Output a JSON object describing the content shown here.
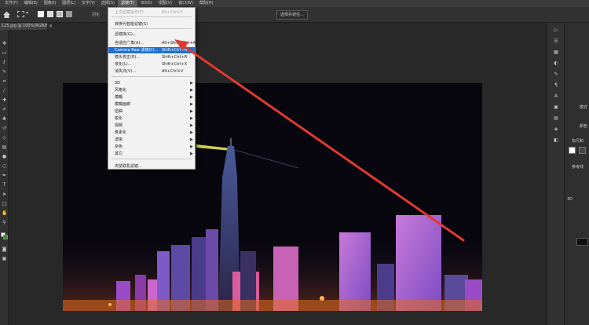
{
  "menubar": {
    "items": [
      "文件(F)",
      "编辑(E)",
      "图像(I)",
      "图层(L)",
      "文字(Y)",
      "选择(S)",
      "滤镜(T)",
      "3D(D)",
      "视图(V)",
      "窗口(W)",
      "帮助(H)"
    ],
    "active_index": 6
  },
  "options": {
    "feather_label": "羽化",
    "select_mask_button": "选择并遮住..."
  },
  "document_tab": {
    "title": "125.jpg @ 100%(RGB/8#)",
    "close_glyph": "×"
  },
  "filter_menu": {
    "items": [
      {
        "label": "上次滤镜操作(F)",
        "shortcut": "Alt+Ctrl+F",
        "disabled": true
      },
      {
        "label": "转换为智能滤镜(S)",
        "shortcut": ""
      },
      {
        "label": "滤镜库(G)...",
        "shortcut": ""
      },
      {
        "label": "自适应广角(A)...",
        "shortcut": "Alt+Shift+Ctrl+A"
      },
      {
        "label": "Camera Raw 滤镜(C)...",
        "shortcut": "Shift+Ctrl+A",
        "selected": true
      },
      {
        "label": "镜头校正(R)...",
        "shortcut": "Shift+Ctrl+R"
      },
      {
        "label": "液化(L)...",
        "shortcut": "Shift+Ctrl+X"
      },
      {
        "label": "消失点(V)...",
        "shortcut": "Alt+Ctrl+V"
      },
      {
        "label": "3D",
        "submenu": true
      },
      {
        "label": "风格化",
        "submenu": true
      },
      {
        "label": "模糊",
        "submenu": true
      },
      {
        "label": "模糊画廊",
        "submenu": true
      },
      {
        "label": "扭曲",
        "submenu": true
      },
      {
        "label": "锐化",
        "submenu": true
      },
      {
        "label": "视频",
        "submenu": true
      },
      {
        "label": "像素化",
        "submenu": true
      },
      {
        "label": "渲染",
        "submenu": true
      },
      {
        "label": "杂色",
        "submenu": true
      },
      {
        "label": "其它",
        "submenu": true
      },
      {
        "label": "浏览联机滤镜...",
        "shortcut": ""
      }
    ],
    "submenu_arrow": "▶"
  },
  "right_panel": {
    "labels": [
      "模式",
      "颜色",
      "标尺和",
      "参考线",
      "3D"
    ]
  },
  "icons": {
    "home": "home-icon",
    "marquee": "rectangular-marquee-icon",
    "close": "close-icon",
    "submenu": "chevron-right-icon"
  },
  "colors": {
    "menu_highlight": "#1e71d3",
    "annotation_arrow": "#e03a2f"
  }
}
